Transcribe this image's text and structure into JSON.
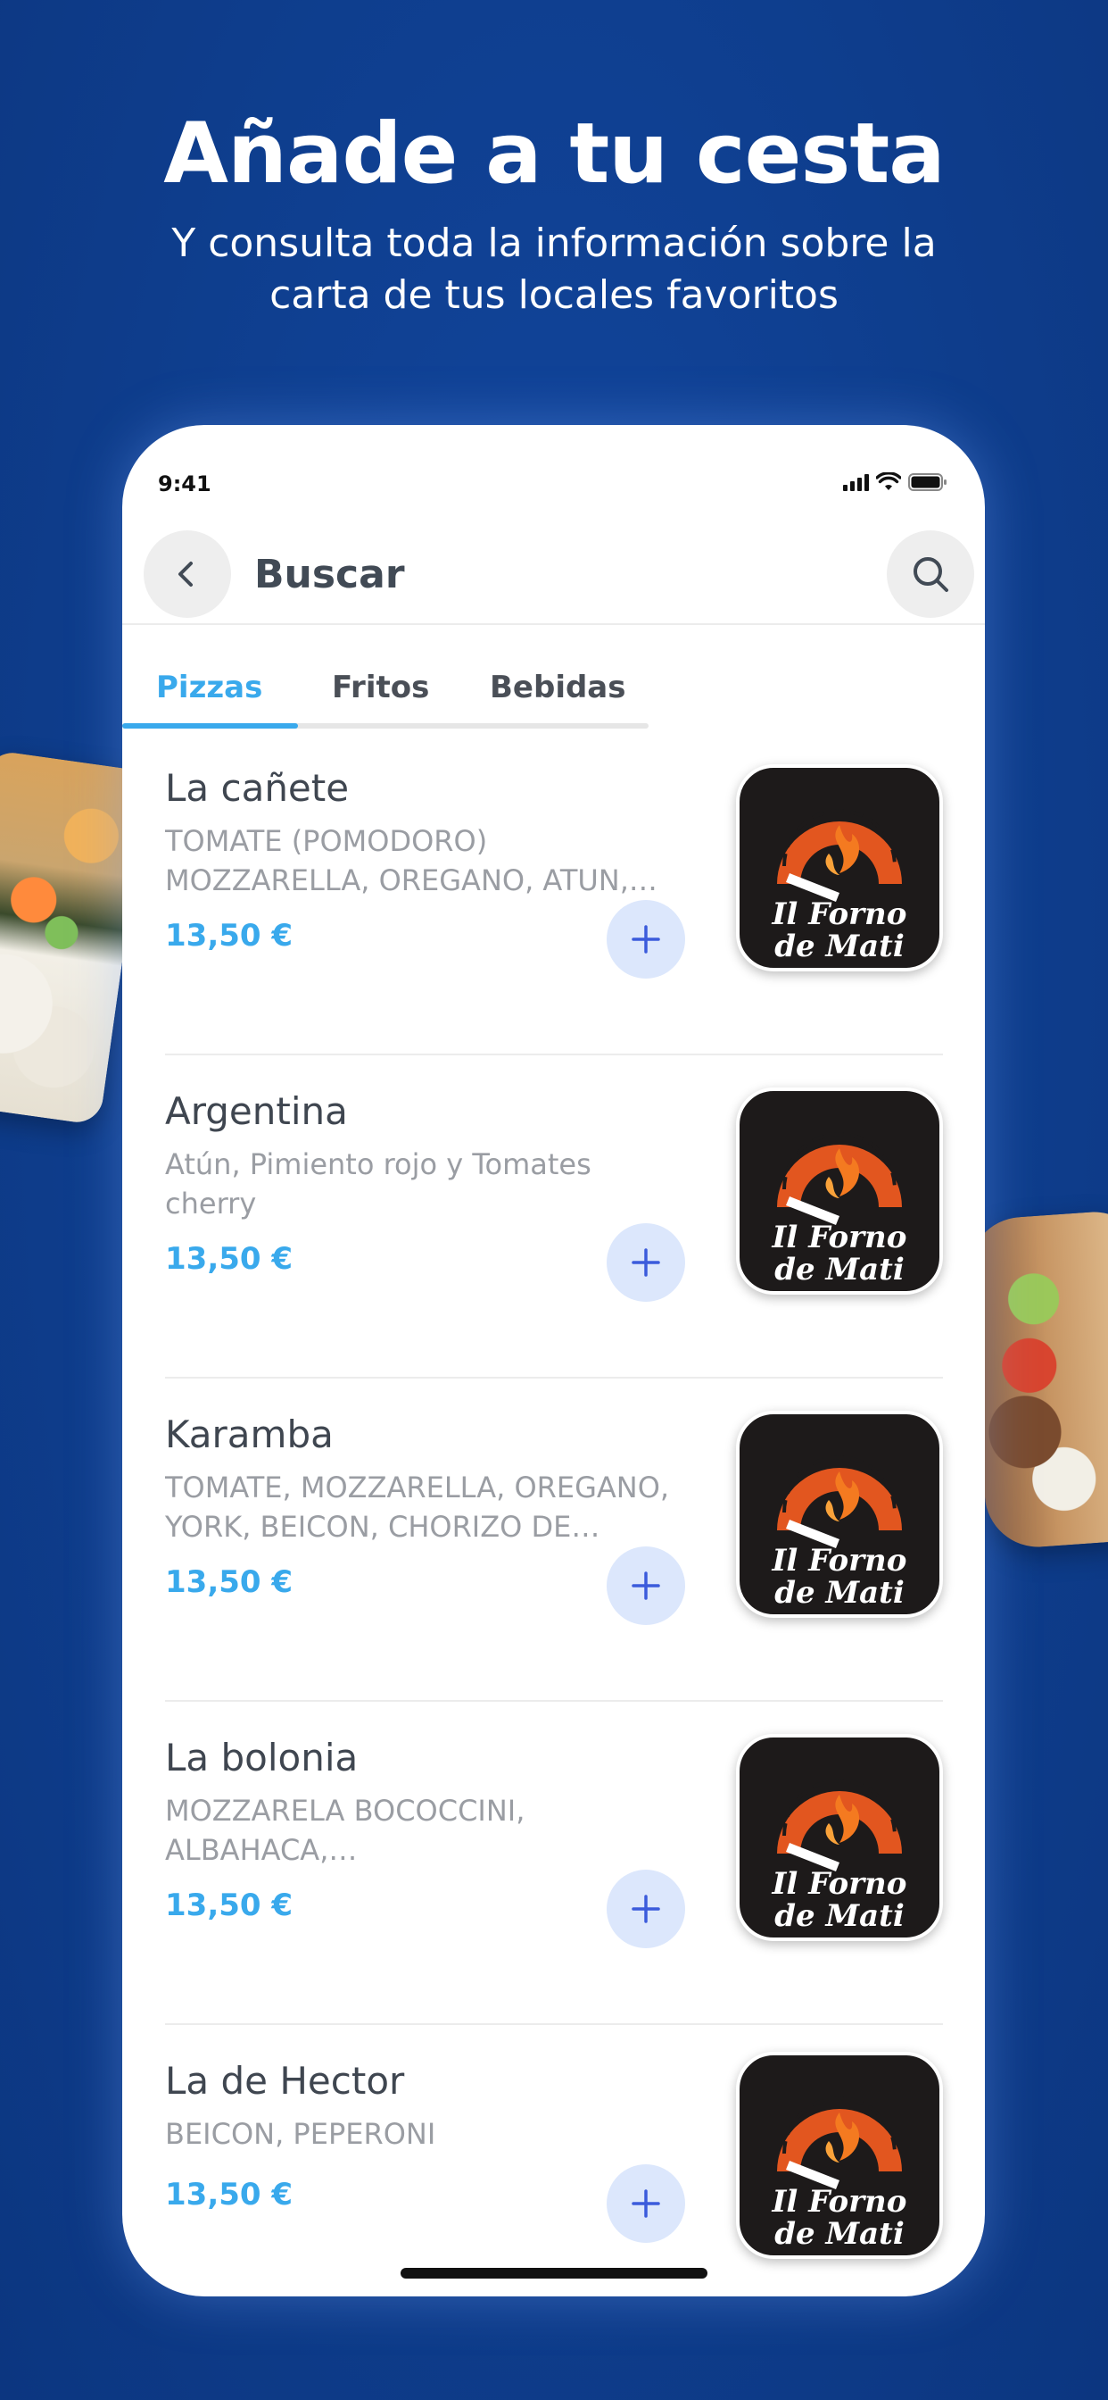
{
  "headline": "Añade a tu cesta",
  "subline": [
    "Y consulta toda la información sobre la",
    "carta de tus locales favoritos"
  ],
  "status_bar": {
    "time": "9:41"
  },
  "navbar": {
    "title": "Buscar"
  },
  "tabs": [
    {
      "label": "Pizzas",
      "active": true
    },
    {
      "label": "Fritos",
      "active": false
    },
    {
      "label": "Bebidas",
      "active": false
    }
  ],
  "items": [
    {
      "name": "La cañete",
      "description": "TOMATE (POMODORO) MOZZARELLA, OREGANO, ATUN, CEBOLLA",
      "price": "13,50 €",
      "logo_text": [
        "Il Forno",
        "de Mati"
      ]
    },
    {
      "name": "Argentina",
      "description": "Atún, Pimiento rojo y Tomates cherry",
      "price": "13,50 €",
      "logo_text": [
        "Il Forno",
        "de Mati"
      ]
    },
    {
      "name": "Karamba",
      "description": "TOMATE, MOZZARELLA, OREGANO, YORK, BEICON, CHORIZO DE PUEBLO",
      "price": "13,50 €",
      "logo_text": [
        "Il Forno",
        "de Mati"
      ]
    },
    {
      "name": "La bolonia",
      "description": "MOZZARELA BOCOCCINI, ALBAHACA, CHAMPIÑON,MORTADELA",
      "price": "13,50 €",
      "logo_text": [
        "Il Forno",
        "de Mati"
      ]
    },
    {
      "name": "La de Hector",
      "description": "BEICON, PEPERONI",
      "price": "13,50 €",
      "logo_text": [
        "Il Forno",
        "de Mati"
      ]
    }
  ],
  "colors": {
    "background": "#0f3f8f",
    "accent": "#39a9ec",
    "add_button": "#dce7fc"
  }
}
